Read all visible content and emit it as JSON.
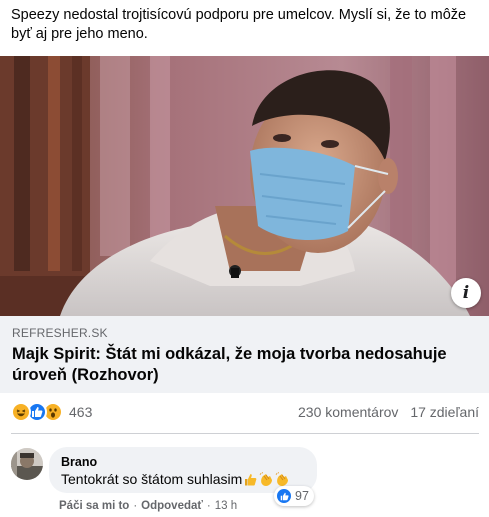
{
  "post": {
    "text": "Speezy nedostal trojtisícovú podporu pre umelcov. Myslí si, že to môže byť aj pre jeho meno."
  },
  "link": {
    "domain": "REFRESHER.SK",
    "title": "Majk Spirit: Štát mi odkázal, že moja tvorba nedosahuje úroveň (Rozhovor)",
    "info_icon": "i"
  },
  "stats": {
    "reaction_icons": [
      "haha-icon",
      "like-icon",
      "wow-icon"
    ],
    "reaction_count": "463",
    "comments": "230 komentárov",
    "shares": "17 zdieľaní"
  },
  "comment": {
    "author": "Brano",
    "text": "Tentokrát so štátom suhlasim",
    "emoji_icons": [
      "thumbs-up-icon",
      "clapping-hands-icon",
      "clapping-hands-icon"
    ],
    "reaction_count": "97",
    "actions": {
      "like": "Páči sa mi to",
      "reply": "Odpovedať",
      "separator": "·",
      "time": "13 h"
    }
  },
  "colors": {
    "facebook_blue": "#1877f2",
    "secondary_text": "#65676b",
    "card_background": "#f0f2f5"
  }
}
